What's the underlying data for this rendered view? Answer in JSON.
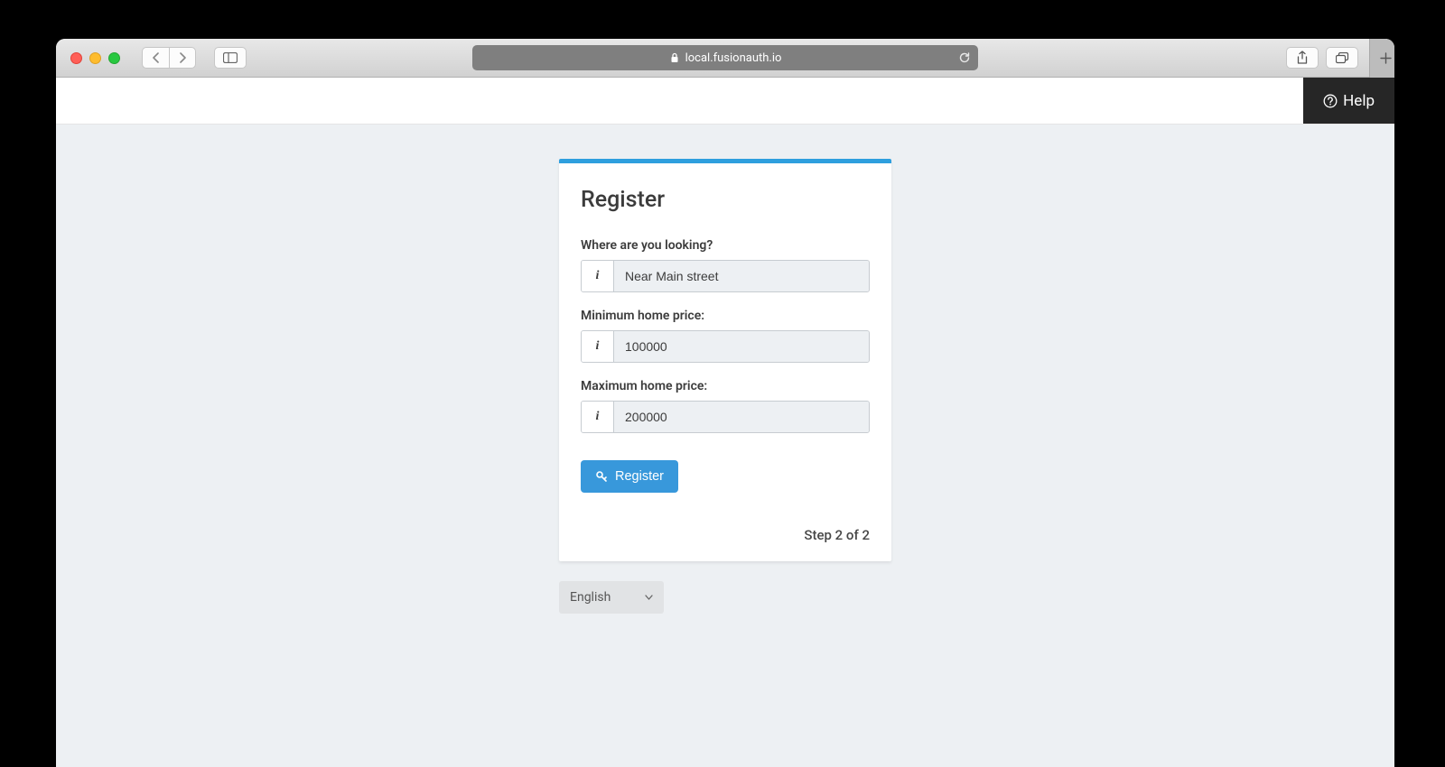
{
  "browser": {
    "url_host": "local.fusionauth.io"
  },
  "header": {
    "help_label": "Help"
  },
  "card": {
    "title": "Register",
    "fields": {
      "location": {
        "label": "Where are you looking?",
        "value": "Near Main street"
      },
      "min_price": {
        "label": "Minimum home price:",
        "value": "100000"
      },
      "max_price": {
        "label": "Maximum home price:",
        "value": "200000"
      }
    },
    "submit_label": "Register",
    "step_text": "Step 2 of 2"
  },
  "language": {
    "selected": "English"
  },
  "info_glyph": "i"
}
